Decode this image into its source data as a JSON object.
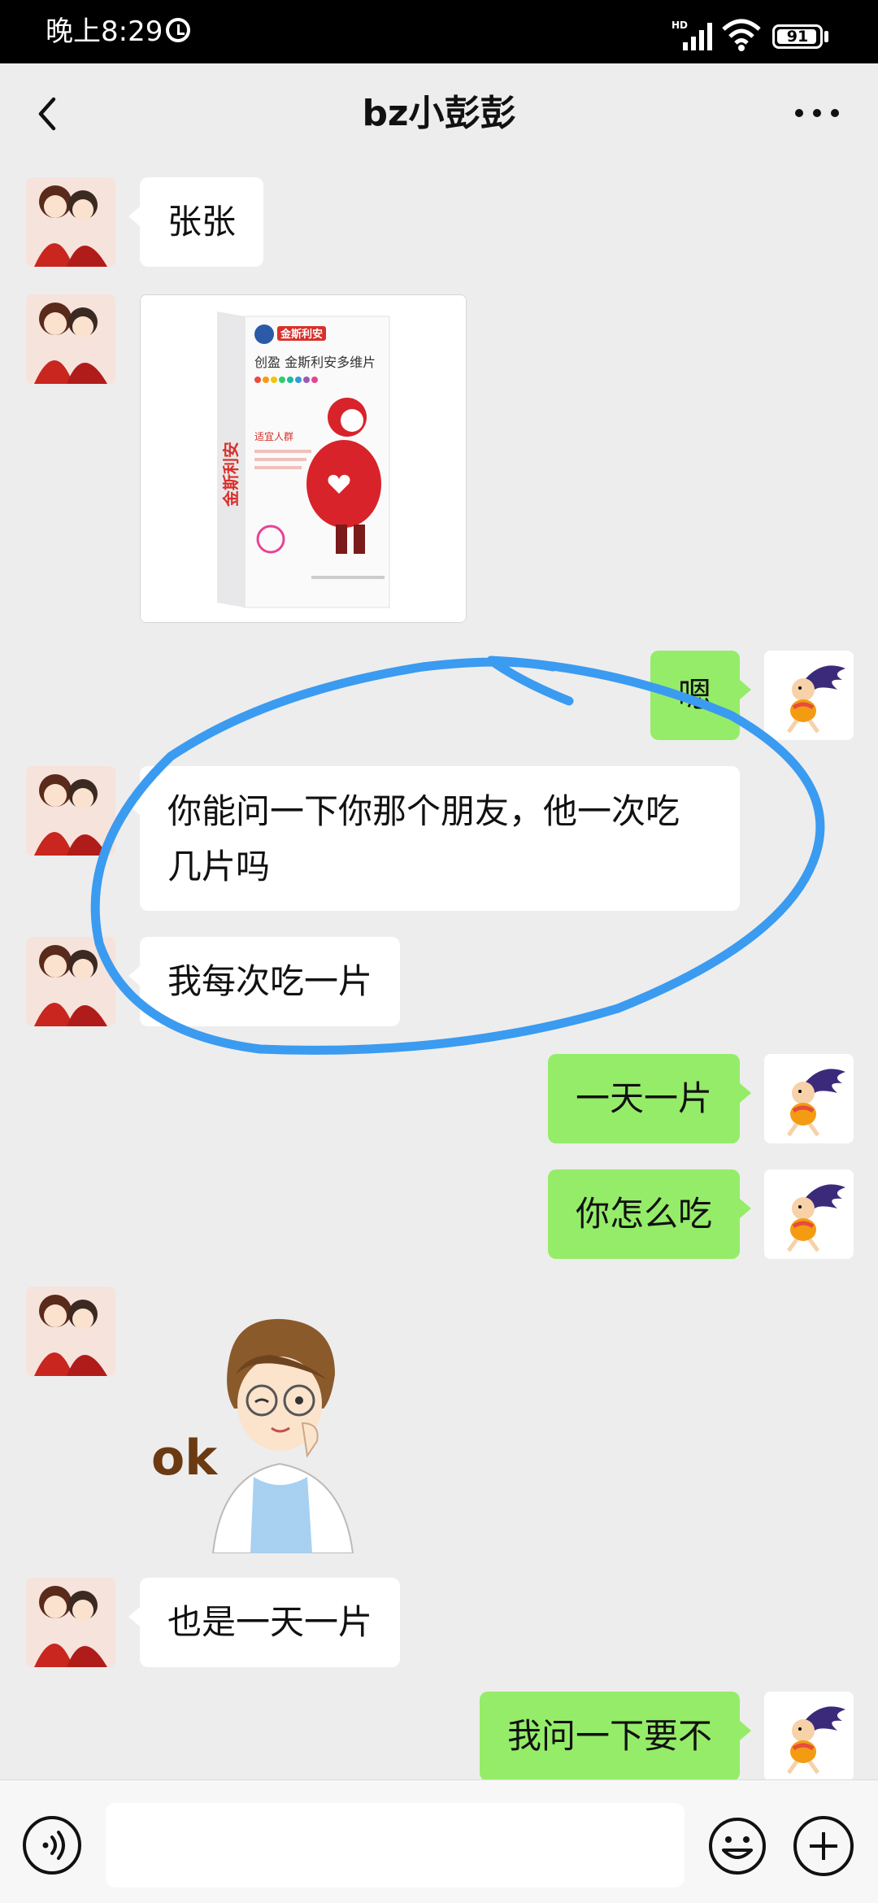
{
  "status_bar": {
    "time": "晚上8:29",
    "network": "HD",
    "battery": "91"
  },
  "header": {
    "title": "bz小彭彭",
    "back_icon": "chevron-left-icon",
    "more_icon": "more-dots-icon"
  },
  "messages": [
    {
      "from": "other",
      "type": "text",
      "text": "张张"
    },
    {
      "from": "other",
      "type": "image",
      "content": {
        "brand": "金斯利安",
        "product": "创盈 金斯利安多维片",
        "label": "适宜人群",
        "side_text": "金斯利安"
      }
    },
    {
      "from": "me",
      "type": "text",
      "text": "嗯"
    },
    {
      "from": "other",
      "type": "text",
      "text": "你能问一下你那个朋友，他一次吃几片吗"
    },
    {
      "from": "other",
      "type": "text",
      "text": "我每次吃一片"
    },
    {
      "from": "me",
      "type": "text",
      "text": "一天一片"
    },
    {
      "from": "me",
      "type": "text",
      "text": "你怎么吃"
    },
    {
      "from": "other",
      "type": "sticker",
      "text": "ok"
    },
    {
      "from": "other",
      "type": "text",
      "text": "也是一天一片"
    },
    {
      "from": "me",
      "type": "text",
      "text": "我问一下要不"
    }
  ],
  "annotation": {
    "shape": "hand-drawn ellipse",
    "color": "#3a9bf0"
  },
  "colors": {
    "background": "#ededed",
    "incoming_bubble": "#ffffff",
    "outgoing_bubble": "#95ec69",
    "annotation": "#3a9bf0"
  },
  "input_bar": {
    "value": "",
    "voice_icon": "voice-icon",
    "emoji_icon": "emoji-icon",
    "plus_icon": "plus-icon"
  }
}
